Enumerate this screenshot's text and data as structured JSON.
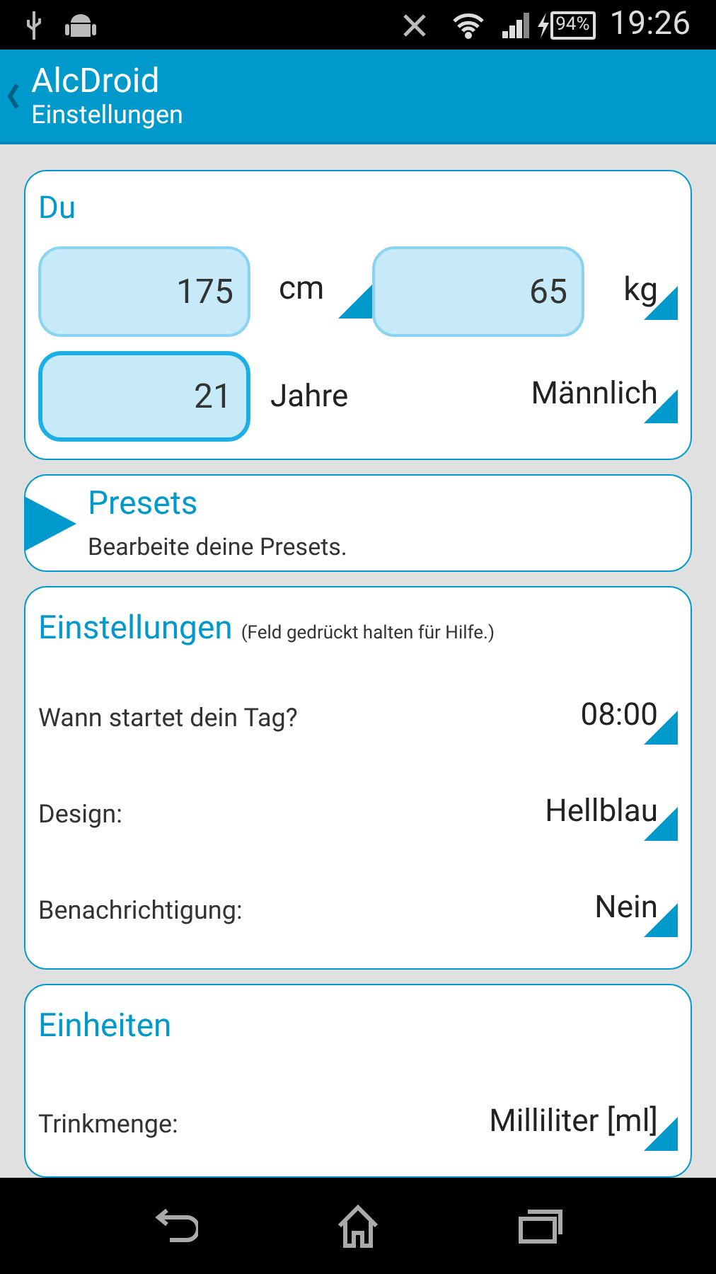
{
  "status_bar": {
    "battery": "94%",
    "time": "19:26"
  },
  "app_bar": {
    "title": "AlcDroid",
    "subtitle": "Einstellungen"
  },
  "profile": {
    "title": "Du",
    "height": {
      "value": "175",
      "unit": "cm",
      "focused": false
    },
    "weight": {
      "value": "65",
      "unit": "kg",
      "focused": false
    },
    "age": {
      "value": "21",
      "unit": "Jahre",
      "focused": true
    },
    "gender": "Männlich"
  },
  "presets": {
    "title": "Presets",
    "description": "Bearbeite deine Presets."
  },
  "settings": {
    "title": "Einstellungen",
    "hint": "(Feld gedrückt halten für Hilfe.)",
    "rows": [
      {
        "label": "Wann startet dein Tag?",
        "value": "08:00"
      },
      {
        "label": "Design:",
        "value": "Hellblau"
      },
      {
        "label": "Benachrichtigung:",
        "value": "Nein"
      }
    ]
  },
  "units": {
    "title": "Einheiten",
    "rows": [
      {
        "label": "Trinkmenge:",
        "value": "Milliliter [ml]"
      }
    ]
  }
}
